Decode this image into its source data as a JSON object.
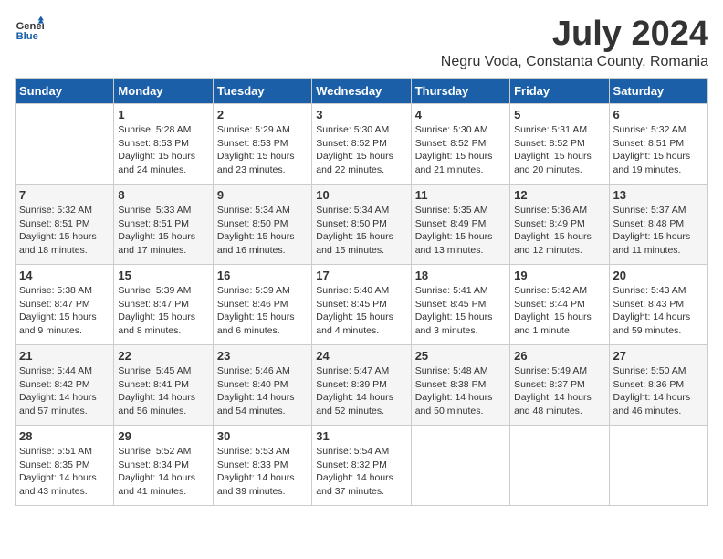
{
  "logo": {
    "general": "General",
    "blue": "Blue"
  },
  "header": {
    "month_year": "July 2024",
    "location": "Negru Voda, Constanta County, Romania"
  },
  "weekdays": [
    "Sunday",
    "Monday",
    "Tuesday",
    "Wednesday",
    "Thursday",
    "Friday",
    "Saturday"
  ],
  "weeks": [
    [
      {
        "day": "",
        "info": ""
      },
      {
        "day": "1",
        "info": "Sunrise: 5:28 AM\nSunset: 8:53 PM\nDaylight: 15 hours\nand 24 minutes."
      },
      {
        "day": "2",
        "info": "Sunrise: 5:29 AM\nSunset: 8:53 PM\nDaylight: 15 hours\nand 23 minutes."
      },
      {
        "day": "3",
        "info": "Sunrise: 5:30 AM\nSunset: 8:52 PM\nDaylight: 15 hours\nand 22 minutes."
      },
      {
        "day": "4",
        "info": "Sunrise: 5:30 AM\nSunset: 8:52 PM\nDaylight: 15 hours\nand 21 minutes."
      },
      {
        "day": "5",
        "info": "Sunrise: 5:31 AM\nSunset: 8:52 PM\nDaylight: 15 hours\nand 20 minutes."
      },
      {
        "day": "6",
        "info": "Sunrise: 5:32 AM\nSunset: 8:51 PM\nDaylight: 15 hours\nand 19 minutes."
      }
    ],
    [
      {
        "day": "7",
        "info": "Sunrise: 5:32 AM\nSunset: 8:51 PM\nDaylight: 15 hours\nand 18 minutes."
      },
      {
        "day": "8",
        "info": "Sunrise: 5:33 AM\nSunset: 8:51 PM\nDaylight: 15 hours\nand 17 minutes."
      },
      {
        "day": "9",
        "info": "Sunrise: 5:34 AM\nSunset: 8:50 PM\nDaylight: 15 hours\nand 16 minutes."
      },
      {
        "day": "10",
        "info": "Sunrise: 5:34 AM\nSunset: 8:50 PM\nDaylight: 15 hours\nand 15 minutes."
      },
      {
        "day": "11",
        "info": "Sunrise: 5:35 AM\nSunset: 8:49 PM\nDaylight: 15 hours\nand 13 minutes."
      },
      {
        "day": "12",
        "info": "Sunrise: 5:36 AM\nSunset: 8:49 PM\nDaylight: 15 hours\nand 12 minutes."
      },
      {
        "day": "13",
        "info": "Sunrise: 5:37 AM\nSunset: 8:48 PM\nDaylight: 15 hours\nand 11 minutes."
      }
    ],
    [
      {
        "day": "14",
        "info": "Sunrise: 5:38 AM\nSunset: 8:47 PM\nDaylight: 15 hours\nand 9 minutes."
      },
      {
        "day": "15",
        "info": "Sunrise: 5:39 AM\nSunset: 8:47 PM\nDaylight: 15 hours\nand 8 minutes."
      },
      {
        "day": "16",
        "info": "Sunrise: 5:39 AM\nSunset: 8:46 PM\nDaylight: 15 hours\nand 6 minutes."
      },
      {
        "day": "17",
        "info": "Sunrise: 5:40 AM\nSunset: 8:45 PM\nDaylight: 15 hours\nand 4 minutes."
      },
      {
        "day": "18",
        "info": "Sunrise: 5:41 AM\nSunset: 8:45 PM\nDaylight: 15 hours\nand 3 minutes."
      },
      {
        "day": "19",
        "info": "Sunrise: 5:42 AM\nSunset: 8:44 PM\nDaylight: 15 hours\nand 1 minute."
      },
      {
        "day": "20",
        "info": "Sunrise: 5:43 AM\nSunset: 8:43 PM\nDaylight: 14 hours\nand 59 minutes."
      }
    ],
    [
      {
        "day": "21",
        "info": "Sunrise: 5:44 AM\nSunset: 8:42 PM\nDaylight: 14 hours\nand 57 minutes."
      },
      {
        "day": "22",
        "info": "Sunrise: 5:45 AM\nSunset: 8:41 PM\nDaylight: 14 hours\nand 56 minutes."
      },
      {
        "day": "23",
        "info": "Sunrise: 5:46 AM\nSunset: 8:40 PM\nDaylight: 14 hours\nand 54 minutes."
      },
      {
        "day": "24",
        "info": "Sunrise: 5:47 AM\nSunset: 8:39 PM\nDaylight: 14 hours\nand 52 minutes."
      },
      {
        "day": "25",
        "info": "Sunrise: 5:48 AM\nSunset: 8:38 PM\nDaylight: 14 hours\nand 50 minutes."
      },
      {
        "day": "26",
        "info": "Sunrise: 5:49 AM\nSunset: 8:37 PM\nDaylight: 14 hours\nand 48 minutes."
      },
      {
        "day": "27",
        "info": "Sunrise: 5:50 AM\nSunset: 8:36 PM\nDaylight: 14 hours\nand 46 minutes."
      }
    ],
    [
      {
        "day": "28",
        "info": "Sunrise: 5:51 AM\nSunset: 8:35 PM\nDaylight: 14 hours\nand 43 minutes."
      },
      {
        "day": "29",
        "info": "Sunrise: 5:52 AM\nSunset: 8:34 PM\nDaylight: 14 hours\nand 41 minutes."
      },
      {
        "day": "30",
        "info": "Sunrise: 5:53 AM\nSunset: 8:33 PM\nDaylight: 14 hours\nand 39 minutes."
      },
      {
        "day": "31",
        "info": "Sunrise: 5:54 AM\nSunset: 8:32 PM\nDaylight: 14 hours\nand 37 minutes."
      },
      {
        "day": "",
        "info": ""
      },
      {
        "day": "",
        "info": ""
      },
      {
        "day": "",
        "info": ""
      }
    ]
  ]
}
